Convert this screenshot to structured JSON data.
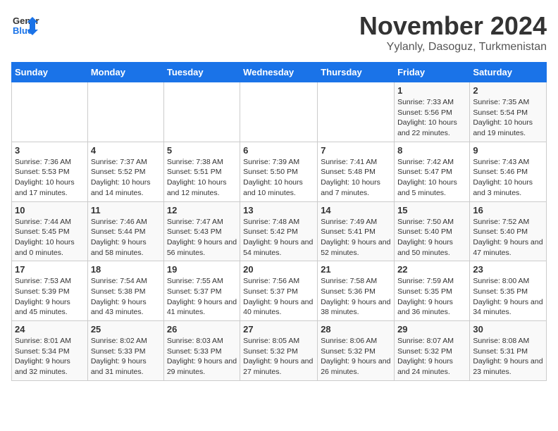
{
  "logo": {
    "line1": "General",
    "line2": "Blue"
  },
  "title": "November 2024",
  "subtitle": "Yylanly, Dasoguz, Turkmenistan",
  "weekdays": [
    "Sunday",
    "Monday",
    "Tuesday",
    "Wednesday",
    "Thursday",
    "Friday",
    "Saturday"
  ],
  "weeks": [
    [
      {
        "day": "",
        "info": ""
      },
      {
        "day": "",
        "info": ""
      },
      {
        "day": "",
        "info": ""
      },
      {
        "day": "",
        "info": ""
      },
      {
        "day": "",
        "info": ""
      },
      {
        "day": "1",
        "info": "Sunrise: 7:33 AM\nSunset: 5:56 PM\nDaylight: 10 hours and 22 minutes."
      },
      {
        "day": "2",
        "info": "Sunrise: 7:35 AM\nSunset: 5:54 PM\nDaylight: 10 hours and 19 minutes."
      }
    ],
    [
      {
        "day": "3",
        "info": "Sunrise: 7:36 AM\nSunset: 5:53 PM\nDaylight: 10 hours and 17 minutes."
      },
      {
        "day": "4",
        "info": "Sunrise: 7:37 AM\nSunset: 5:52 PM\nDaylight: 10 hours and 14 minutes."
      },
      {
        "day": "5",
        "info": "Sunrise: 7:38 AM\nSunset: 5:51 PM\nDaylight: 10 hours and 12 minutes."
      },
      {
        "day": "6",
        "info": "Sunrise: 7:39 AM\nSunset: 5:50 PM\nDaylight: 10 hours and 10 minutes."
      },
      {
        "day": "7",
        "info": "Sunrise: 7:41 AM\nSunset: 5:48 PM\nDaylight: 10 hours and 7 minutes."
      },
      {
        "day": "8",
        "info": "Sunrise: 7:42 AM\nSunset: 5:47 PM\nDaylight: 10 hours and 5 minutes."
      },
      {
        "day": "9",
        "info": "Sunrise: 7:43 AM\nSunset: 5:46 PM\nDaylight: 10 hours and 3 minutes."
      }
    ],
    [
      {
        "day": "10",
        "info": "Sunrise: 7:44 AM\nSunset: 5:45 PM\nDaylight: 10 hours and 0 minutes."
      },
      {
        "day": "11",
        "info": "Sunrise: 7:46 AM\nSunset: 5:44 PM\nDaylight: 9 hours and 58 minutes."
      },
      {
        "day": "12",
        "info": "Sunrise: 7:47 AM\nSunset: 5:43 PM\nDaylight: 9 hours and 56 minutes."
      },
      {
        "day": "13",
        "info": "Sunrise: 7:48 AM\nSunset: 5:42 PM\nDaylight: 9 hours and 54 minutes."
      },
      {
        "day": "14",
        "info": "Sunrise: 7:49 AM\nSunset: 5:41 PM\nDaylight: 9 hours and 52 minutes."
      },
      {
        "day": "15",
        "info": "Sunrise: 7:50 AM\nSunset: 5:40 PM\nDaylight: 9 hours and 50 minutes."
      },
      {
        "day": "16",
        "info": "Sunrise: 7:52 AM\nSunset: 5:40 PM\nDaylight: 9 hours and 47 minutes."
      }
    ],
    [
      {
        "day": "17",
        "info": "Sunrise: 7:53 AM\nSunset: 5:39 PM\nDaylight: 9 hours and 45 minutes."
      },
      {
        "day": "18",
        "info": "Sunrise: 7:54 AM\nSunset: 5:38 PM\nDaylight: 9 hours and 43 minutes."
      },
      {
        "day": "19",
        "info": "Sunrise: 7:55 AM\nSunset: 5:37 PM\nDaylight: 9 hours and 41 minutes."
      },
      {
        "day": "20",
        "info": "Sunrise: 7:56 AM\nSunset: 5:37 PM\nDaylight: 9 hours and 40 minutes."
      },
      {
        "day": "21",
        "info": "Sunrise: 7:58 AM\nSunset: 5:36 PM\nDaylight: 9 hours and 38 minutes."
      },
      {
        "day": "22",
        "info": "Sunrise: 7:59 AM\nSunset: 5:35 PM\nDaylight: 9 hours and 36 minutes."
      },
      {
        "day": "23",
        "info": "Sunrise: 8:00 AM\nSunset: 5:35 PM\nDaylight: 9 hours and 34 minutes."
      }
    ],
    [
      {
        "day": "24",
        "info": "Sunrise: 8:01 AM\nSunset: 5:34 PM\nDaylight: 9 hours and 32 minutes."
      },
      {
        "day": "25",
        "info": "Sunrise: 8:02 AM\nSunset: 5:33 PM\nDaylight: 9 hours and 31 minutes."
      },
      {
        "day": "26",
        "info": "Sunrise: 8:03 AM\nSunset: 5:33 PM\nDaylight: 9 hours and 29 minutes."
      },
      {
        "day": "27",
        "info": "Sunrise: 8:05 AM\nSunset: 5:32 PM\nDaylight: 9 hours and 27 minutes."
      },
      {
        "day": "28",
        "info": "Sunrise: 8:06 AM\nSunset: 5:32 PM\nDaylight: 9 hours and 26 minutes."
      },
      {
        "day": "29",
        "info": "Sunrise: 8:07 AM\nSunset: 5:32 PM\nDaylight: 9 hours and 24 minutes."
      },
      {
        "day": "30",
        "info": "Sunrise: 8:08 AM\nSunset: 5:31 PM\nDaylight: 9 hours and 23 minutes."
      }
    ]
  ]
}
